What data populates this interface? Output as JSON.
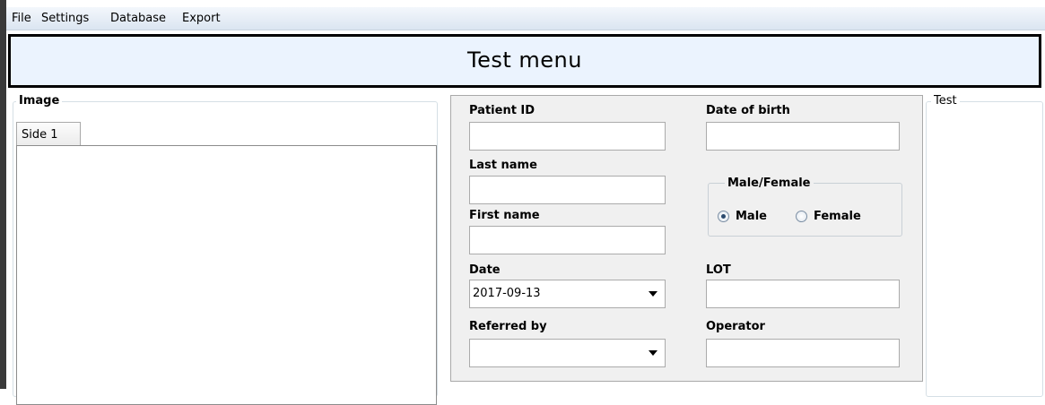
{
  "menu": {
    "items": [
      "File",
      "Settings",
      "Database",
      "Export"
    ]
  },
  "title": "Test menu",
  "image_panel": {
    "title": "Image",
    "tabs": [
      "Side 1"
    ]
  },
  "patient_form": {
    "patient_id": {
      "label": "Patient ID",
      "value": ""
    },
    "date_of_birth": {
      "label": "Date of birth",
      "value": ""
    },
    "last_name": {
      "label": "Last name",
      "value": ""
    },
    "first_name": {
      "label": "First name",
      "value": ""
    },
    "gender": {
      "title": "Male/Female",
      "options": [
        "Male",
        "Female"
      ],
      "selected": "Male"
    },
    "date": {
      "label": "Date",
      "value": "2017-09-13"
    },
    "lot": {
      "label": "LOT",
      "value": ""
    },
    "referred_by": {
      "label": "Referred by",
      "value": ""
    },
    "operator": {
      "label": "Operator",
      "value": ""
    }
  },
  "test_panel": {
    "title": "Test"
  },
  "colors": {
    "title_banner_bg": "#ebf3fe",
    "form_bg": "#f0f0f0",
    "menubar_bg": "#dbe5f1"
  }
}
